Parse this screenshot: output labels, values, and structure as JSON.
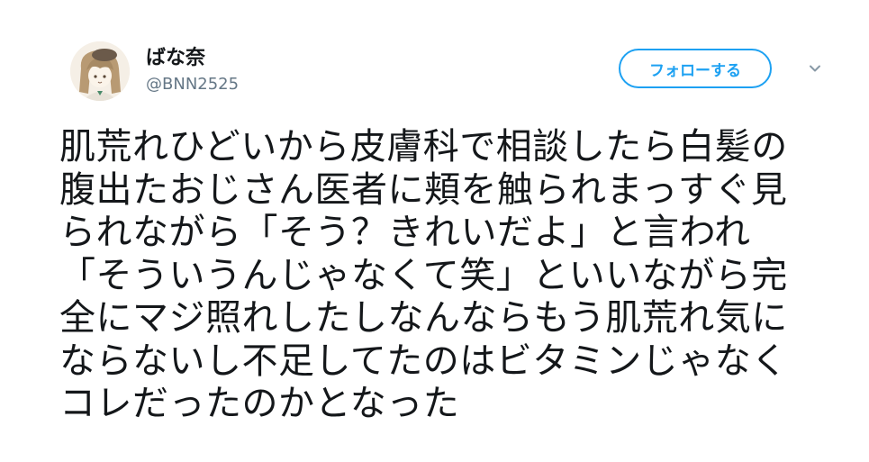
{
  "user": {
    "display_name": "ばな奈",
    "handle": "@BNN2525",
    "avatar_icon": "illustrated-girl-avatar"
  },
  "follow_button": {
    "label": "フォローする"
  },
  "menu": {
    "icon": "chevron-down-icon"
  },
  "tweet": {
    "lines": [
      "肌荒れひどいから皮膚科で相談したら白髪の",
      "腹出たおじさん医者に頬を触られまっすぐ見",
      "られながら「そう？きれいだよ」と言われ",
      "「そういうんじゃなくて笑」といいながら完",
      "全にマジ照れしたしなんならもう肌荒れ気に",
      "ならないし不足してたのはビタミンじゃなく",
      "コレだったのかとなった"
    ]
  },
  "colors": {
    "accent": "#1da1f2",
    "text": "#14171a",
    "secondary_text": "#657786",
    "background": "#ffffff"
  }
}
